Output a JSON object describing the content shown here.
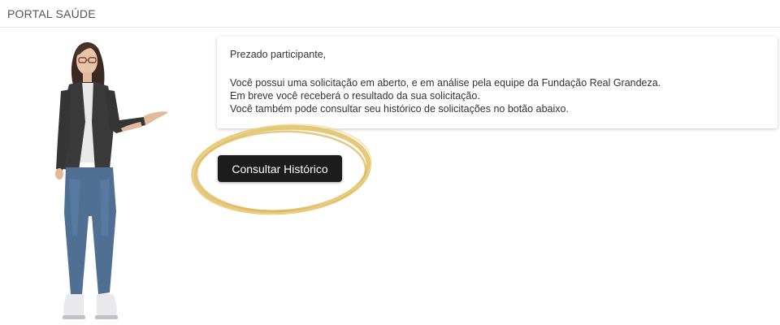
{
  "header": {
    "title": "PORTAL SAÚDE"
  },
  "avatar": {
    "icon": "assistant-avatar-icon"
  },
  "message": {
    "greeting": "Prezado participante,",
    "lines": [
      "Você possui uma solicitação em aberto, e em análise pela equipe da Fundação Real Grandeza.",
      "Em breve você receberá o resultado da sua solicitação.",
      "Você também pode consultar seu histórico de solicitações no botão abaixo."
    ]
  },
  "actions": {
    "history_label": "Consultar Histórico"
  },
  "colors": {
    "button_bg": "#1c1c1c",
    "highlight_ring": "#e2c36a",
    "title_text": "#555555"
  }
}
